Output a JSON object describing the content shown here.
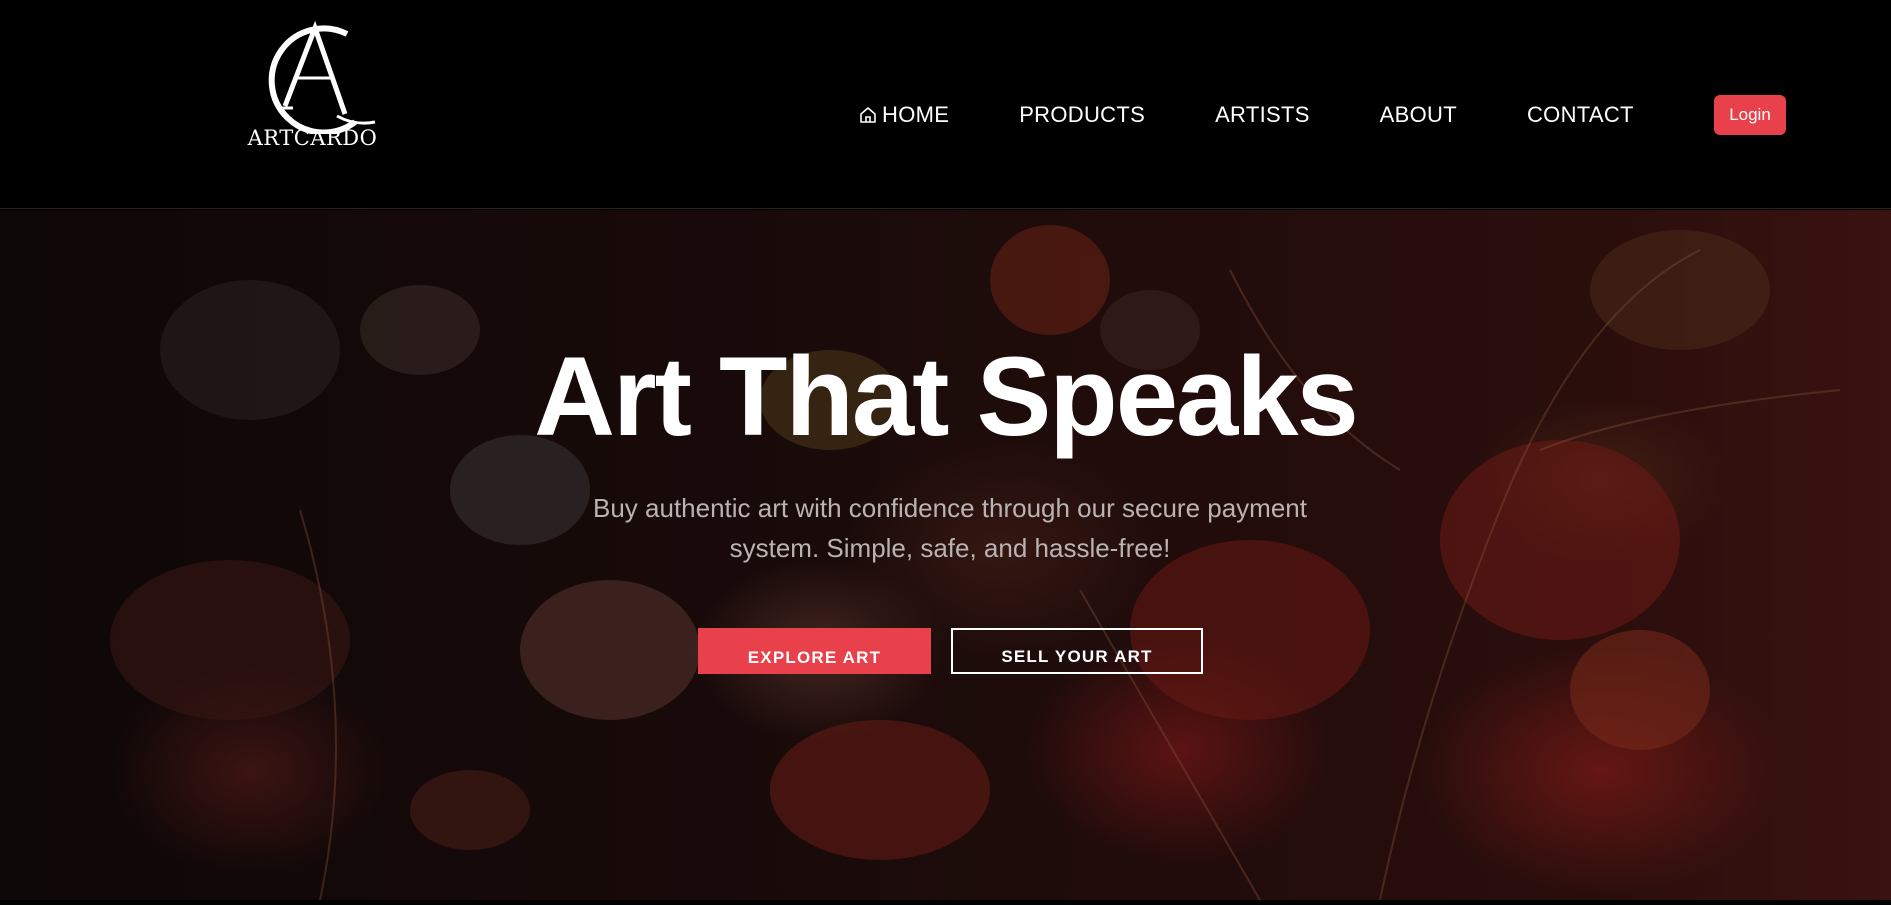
{
  "brand": {
    "logo_word": "ARTCARDO",
    "logo_monogram": "CA"
  },
  "nav": {
    "items": [
      {
        "label": "HOME",
        "icon": "home-icon"
      },
      {
        "label": "PRODUCTS"
      },
      {
        "label": "ARTISTS"
      },
      {
        "label": "ABOUT"
      },
      {
        "label": "CONTACT"
      }
    ],
    "login_label": "Login"
  },
  "hero": {
    "title": "Art That Speaks",
    "subtitle": "Buy authentic art with confidence through our secure payment system. Simple, safe, and hassle-free!",
    "primary_button": "EXPLORE ART",
    "secondary_button": "SELL YOUR ART",
    "background": "dark floral still-life painting"
  },
  "colors": {
    "accent": "#e8414b",
    "header_bg": "#000000",
    "text": "#ffffff",
    "subtitle_text": "#b9b3b2"
  }
}
